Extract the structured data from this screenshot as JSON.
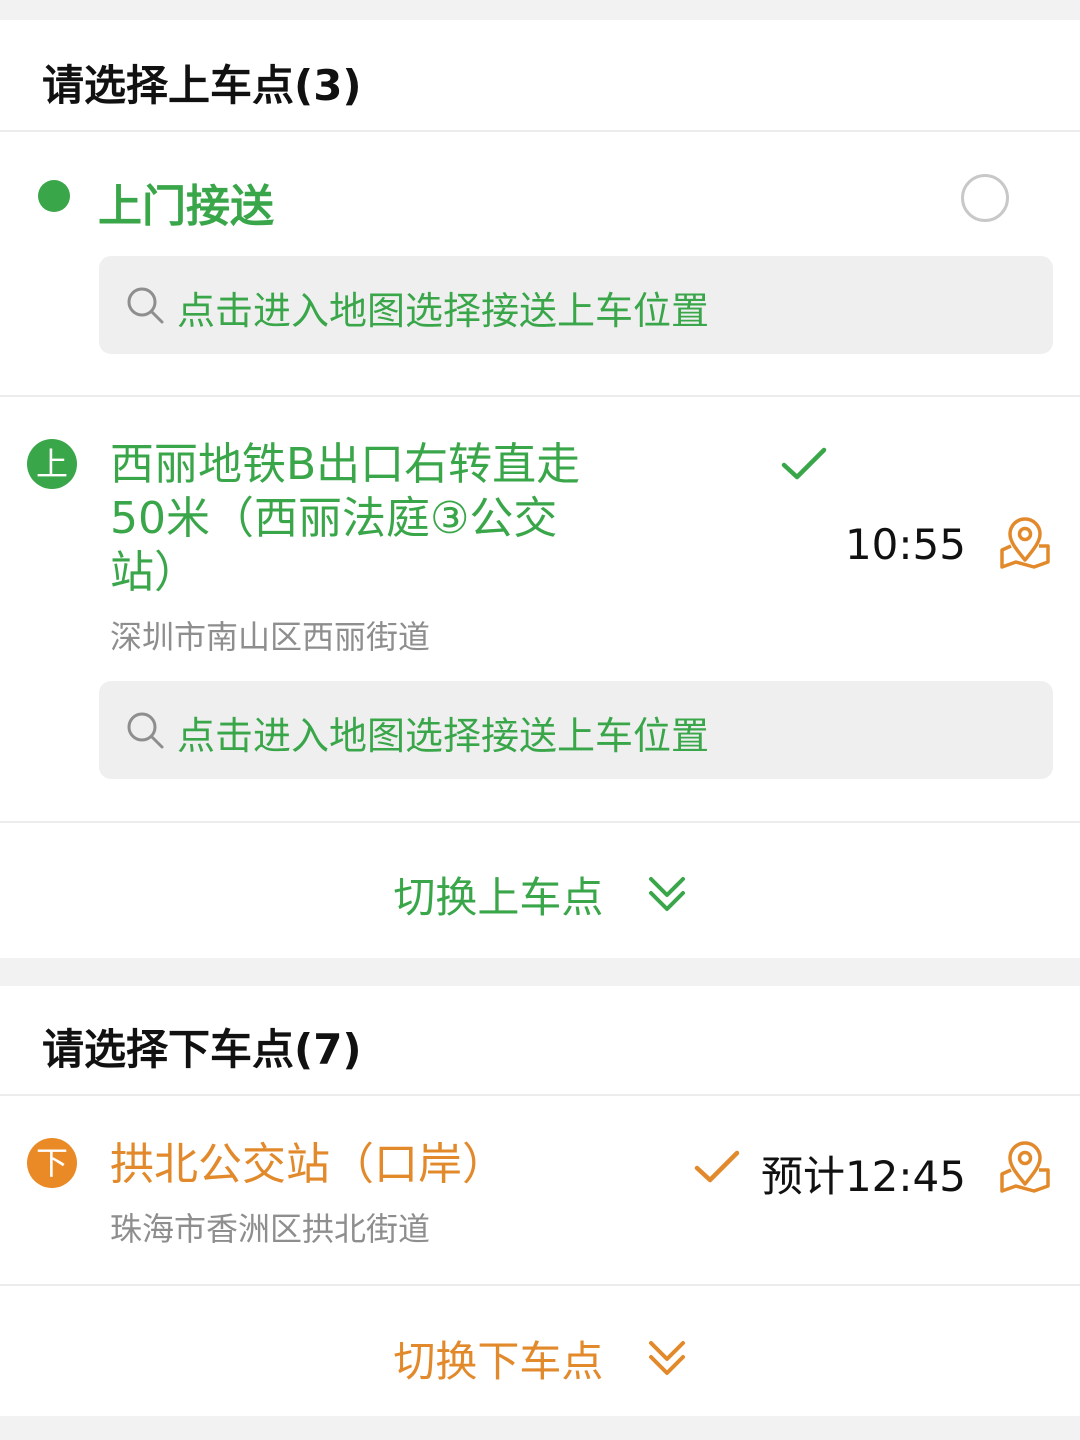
{
  "pickup": {
    "section_title": "请选择上车点(3)",
    "door_to_door": {
      "title": "上门接送",
      "search_placeholder": "点击进入地图选择接送上车位置"
    },
    "stop": {
      "badge": "上",
      "name": "西丽地铁B出口右转直走50米（西丽法庭③公交站）",
      "address": "深圳市南山区西丽街道",
      "time": "10:55",
      "search_placeholder": "点击进入地图选择接送上车位置"
    },
    "switch_label": "切换上车点"
  },
  "dropoff": {
    "section_title": "请选择下车点(7)",
    "stop": {
      "badge": "下",
      "name": "拱北公交站（口岸）",
      "address": "珠海市香洲区拱北街道",
      "time": "预计12:45"
    },
    "switch_label": "切换下车点"
  },
  "colors": {
    "green": "#3aa64a",
    "orange": "#e28a2b",
    "page_bg": "#f2f2f2",
    "search_bg": "#efefef"
  },
  "icons": [
    "search-icon",
    "check-icon",
    "map-pin-icon",
    "double-chevron-down-icon",
    "radio-button"
  ]
}
